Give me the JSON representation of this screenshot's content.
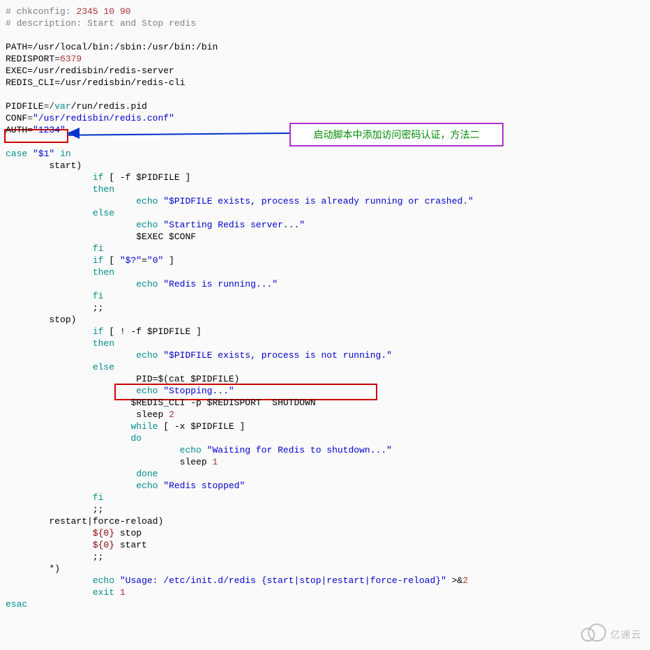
{
  "annotations": {
    "callout_text": "启动脚本中添加访问密码认证，方法二",
    "watermark": "亿速云"
  },
  "script": {
    "comments": {
      "chkconfig_label": "# chkconfig:",
      "chkconfig_value": "2345 10 90",
      "description": "# description: Start and Stop redis"
    },
    "vars": {
      "path_key": "PATH",
      "path_val": "=/usr/local/bin:/sbin:/usr/bin:/bin",
      "redisport_key": "REDISPORT",
      "redisport_val": "6379",
      "exec_key": "EXEC",
      "exec_val": "=/usr/redisbin/redis-server",
      "cli_key": "REDIS_CLI",
      "cli_val": "=/usr/redisbin/redis-cli",
      "pidfile_key": "PIDFILE",
      "pidfile_var": "var",
      "pidfile_rest": "/run/redis.pid",
      "conf_key": "CONF",
      "conf_val": "\"/usr/redisbin/redis.conf\"",
      "auth_key": "AUTH",
      "auth_val": "\"1234\""
    },
    "case": {
      "case_kw": "case",
      "case_arg": "\"$1\"",
      "in_kw": "in",
      "start_label": "start)",
      "stop_label": "stop)",
      "restart_label": "restart|force-reload)",
      "star_label": "*)",
      "esac": "esac"
    },
    "body": {
      "if_kw": "if",
      "then_kw": "then",
      "else_kw": "else",
      "fi_kw": "fi",
      "echo_kw": "echo",
      "while_kw": "while",
      "do_kw": "do",
      "done_kw": "done",
      "sleep_kw": "sleep",
      "exit_kw": "exit",
      "semi": ";;",
      "start_test": "[ -f $PIDFILE ]",
      "start_exists_msg": "\"$PIDFILE exists, process is already running or crashed.\"",
      "start_starting_msg": "\"Starting Redis server...\"",
      "start_exec": "$EXEC $CONF",
      "zero_test_open": "[",
      "zero_test_var": "\"$?\"",
      "zero_test_eq": "=",
      "zero_test_val": "\"0\"",
      "zero_test_close": "]",
      "running_msg": "\"Redis is running...\"",
      "stop_test": "[ ! -f $PIDFILE ]",
      "stop_notrunning_msg": "\"$PIDFILE exists, process is not running.\"",
      "pid_assign": "PID=$(cat $PIDFILE)",
      "stopping_msg": "\"Stopping...\"",
      "shutdown_line": "$REDIS_CLI -p $REDISPORT  SHUTDOWN",
      "sleep_2": "2",
      "while_test": "[ -x $PIDFILE ]",
      "waiting_msg": "\"Waiting for Redis to shutdown...\"",
      "sleep_1": "1",
      "stopped_msg": "\"Redis stopped\"",
      "restart_stop": " stop",
      "restart_start": " start",
      "restart_zero": "${0}",
      "usage_msg": "\"Usage: /etc/init.d/redis {start|stop|restart|force-reload}\"",
      "stderr": ">&",
      "stderr_n": "2",
      "exit_1": "1"
    }
  }
}
